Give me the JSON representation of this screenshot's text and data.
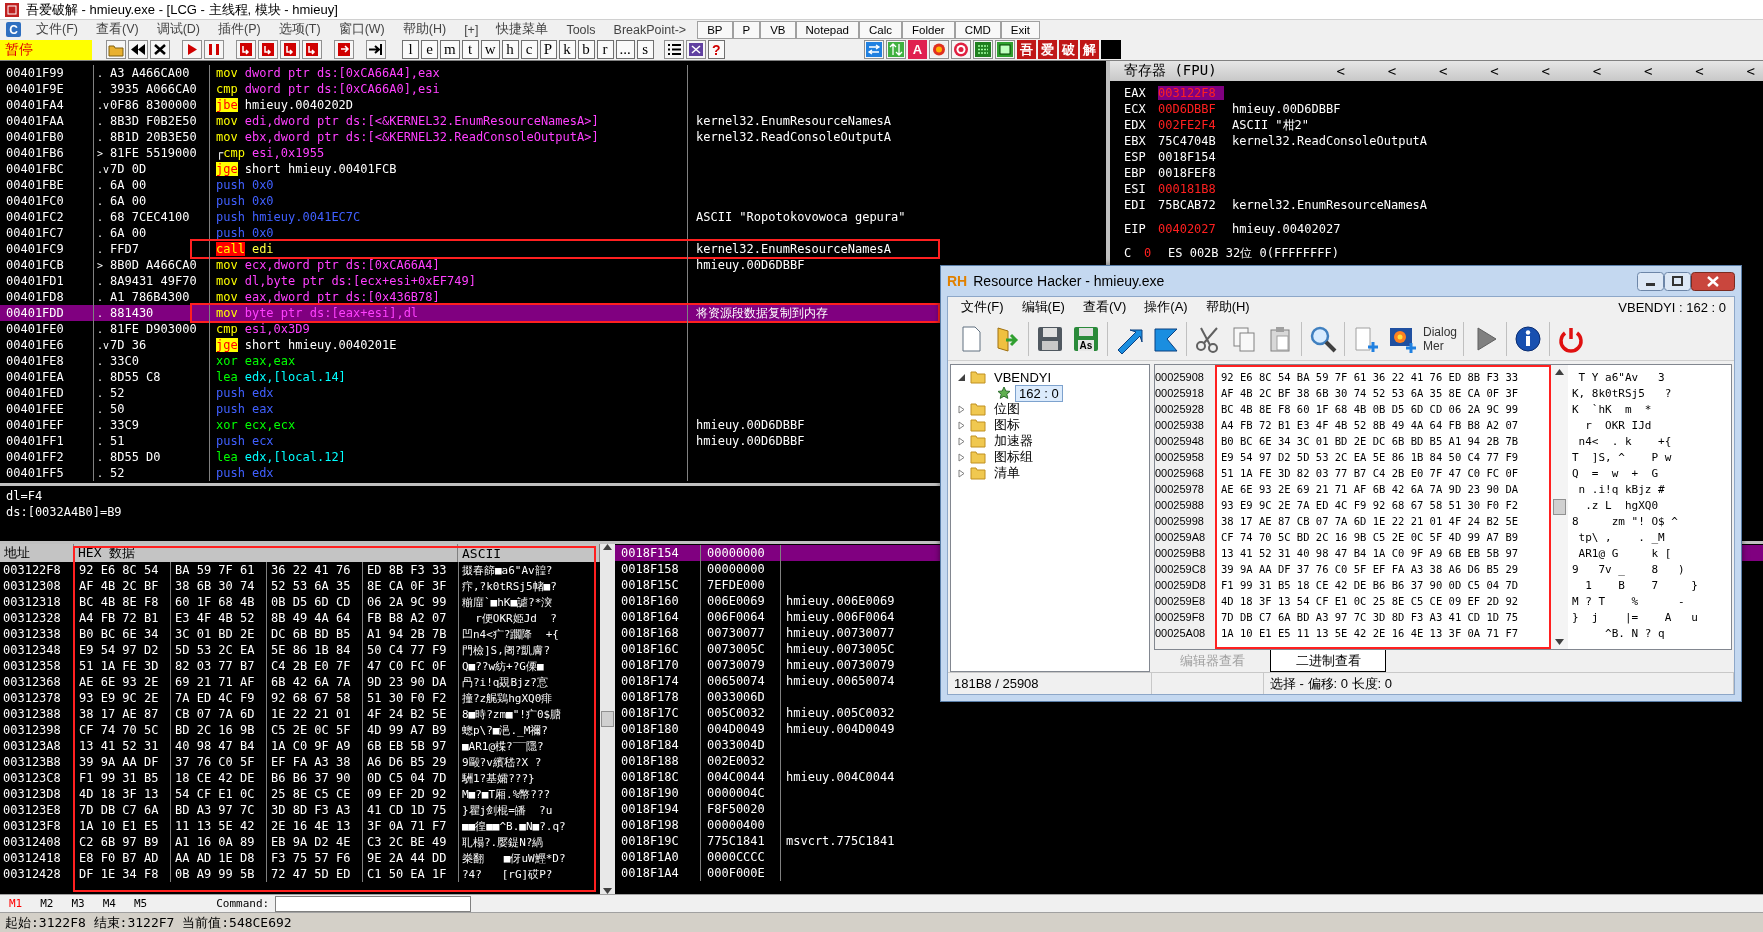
{
  "window": {
    "title": "吾爱破解 - hmieuy.exe - [LCG - 主线程, 模块 - hmieuy]"
  },
  "menu": {
    "logo": "C",
    "items": [
      "文件(F)",
      "查看(V)",
      "调试(D)",
      "插件(P)",
      "选项(T)",
      "窗口(W)",
      "帮助(H)",
      "[+]",
      "快捷菜单",
      "Tools",
      "BreakPoint->"
    ],
    "quick_buttons": [
      "BP",
      "P",
      "VB",
      "Notepad",
      "Calc",
      "Folder",
      "CMD",
      "Exit"
    ]
  },
  "toolbar": {
    "status": "暂停",
    "letter_buttons": [
      "l",
      "e",
      "m",
      "t",
      "w",
      "h",
      "c",
      "P",
      "k",
      "b",
      "r",
      "...",
      "s"
    ],
    "help": "?",
    "letter_icon": "A",
    "brand_keys": [
      "吾",
      "爱",
      "破",
      "解"
    ]
  },
  "disassembly": {
    "rows": [
      {
        "address": "00401F99",
        "mark": ".",
        "bytes": "A3 A466CA00",
        "op": "mov",
        "args": "dword ptr ds:[0xCA66A4],eax",
        "kind": "mov",
        "selected": false,
        "boxed": false
      },
      {
        "address": "00401F9E",
        "mark": ".",
        "bytes": "3935 A066CA0",
        "op": "cmp",
        "args": "dword ptr ds:[0xCA66A0],esi",
        "kind": "mov",
        "selected": false,
        "boxed": false
      },
      {
        "address": "00401FA4",
        "mark": ".v",
        "bytes": "0F86 8300000",
        "op": "jbe",
        "args": "hmieuy.0040202D",
        "kind": "jump",
        "selected": false,
        "boxed": false
      },
      {
        "address": "00401FAA",
        "mark": ".",
        "bytes": "8B3D F0B2E50",
        "op": "mov",
        "args": "edi,dword ptr ds:[<&KERNEL32.EnumResourceNamesA>]",
        "kind": "mov",
        "comment": "kernel32.EnumResourceNamesA",
        "selected": false,
        "boxed": false
      },
      {
        "address": "00401FB0",
        "mark": ".",
        "bytes": "8B1D 20B3E50",
        "op": "mov",
        "args": "ebx,dword ptr ds:[<&KERNEL32.ReadConsoleOutputA>]",
        "kind": "mov",
        "comment": "kernel32.ReadConsoleOutputA",
        "selected": false,
        "boxed": false
      },
      {
        "address": "00401FB6",
        "mark": ">",
        "bytes": "81FE 5519000",
        "loop": "┌",
        "op": "cmp",
        "args": "esi,0x1955",
        "kind": "mov",
        "selected": false,
        "boxed": false
      },
      {
        "address": "00401FBC",
        "mark": ".v",
        "bytes": "7D 0D",
        "op": "jge",
        "args": "short hmieuy.00401FCB",
        "kind": "jump",
        "selected": false,
        "boxed": false
      },
      {
        "address": "00401FBE",
        "mark": ".",
        "bytes": "6A 00",
        "op": "push",
        "args": "0x0",
        "kind": "push",
        "selected": false,
        "boxed": false
      },
      {
        "address": "00401FC0",
        "mark": ".",
        "bytes": "6A 00",
        "op": "push",
        "args": "0x0",
        "kind": "push",
        "selected": false,
        "boxed": false
      },
      {
        "address": "00401FC2",
        "mark": ".",
        "bytes": "68 7CEC4100",
        "op": "push",
        "args": "hmieuy.0041EC7C",
        "kind": "push",
        "comment": "ASCII \"Ropotokovowoca gepura\"",
        "selected": false,
        "boxed": false
      },
      {
        "address": "00401FC7",
        "mark": ".",
        "bytes": "6A 00",
        "op": "push",
        "args": "0x0",
        "kind": "push",
        "selected": false,
        "boxed": false
      },
      {
        "address": "00401FC9",
        "mark": ".",
        "bytes": "FFD7",
        "op": "call",
        "args": "edi",
        "kind": "call",
        "comment": "kernel32.EnumResourceNamesA",
        "selected": false,
        "boxed": true
      },
      {
        "address": "00401FCB",
        "mark": ">",
        "bytes": "8B0D A466CA0",
        "op": "mov",
        "args": "ecx,dword ptr ds:[0xCA66A4]",
        "kind": "mov",
        "comment": "hmieuy.00D6DBBF",
        "selected": false,
        "boxed": false
      },
      {
        "address": "00401FD1",
        "mark": ".",
        "bytes": "8A9431 49F70",
        "op": "mov",
        "args": "dl,byte ptr ds:[ecx+esi+0xEF749]",
        "kind": "mov",
        "selected": false,
        "boxed": false
      },
      {
        "address": "00401FD8",
        "mark": ".",
        "bytes": "A1 786B4300",
        "op": "mov",
        "args": "eax,dword ptr ds:[0x436B78]",
        "kind": "mov",
        "selected": false,
        "boxed": false
      },
      {
        "address": "00401FDD",
        "mark": ".",
        "bytes": "881430",
        "op": "mov",
        "args": "byte ptr ds:[eax+esi],dl",
        "kind": "mov",
        "comment": "将资源段数据复制到内存",
        "selected": true,
        "boxed": true
      },
      {
        "address": "00401FE0",
        "mark": ".",
        "bytes": "81FE D903000",
        "op": "cmp",
        "args": "esi,0x3D9",
        "kind": "mov",
        "selected": false,
        "boxed": false
      },
      {
        "address": "00401FE6",
        "mark": ".v",
        "bytes": "7D 36",
        "op": "jge",
        "args": "short hmieuy.0040201E",
        "kind": "jump",
        "selected": false,
        "boxed": false
      },
      {
        "address": "00401FE8",
        "mark": ".",
        "bytes": "33C0",
        "op": "xor",
        "args": "eax,eax",
        "kind": "arith",
        "selected": false,
        "boxed": false
      },
      {
        "address": "00401FEA",
        "mark": ".",
        "bytes": "8D55 C8",
        "op": "lea",
        "args": "edx,[local.14]",
        "kind": "lea",
        "selected": false,
        "boxed": false
      },
      {
        "address": "00401FED",
        "mark": ".",
        "bytes": "52",
        "op": "push",
        "args": "edx",
        "kind": "push",
        "selected": false,
        "boxed": false
      },
      {
        "address": "00401FEE",
        "mark": ".",
        "bytes": "50",
        "op": "push",
        "args": "eax",
        "kind": "push",
        "selected": false,
        "boxed": false
      },
      {
        "address": "00401FEF",
        "mark": ".",
        "bytes": "33C9",
        "op": "xor",
        "args": "ecx,ecx",
        "kind": "arith",
        "comment": "hmieuy.00D6DBBF",
        "selected": false,
        "boxed": false
      },
      {
        "address": "00401FF1",
        "mark": ".",
        "bytes": "51",
        "op": "push",
        "args": "ecx",
        "kind": "push",
        "comment": "hmieuy.00D6DBBF",
        "selected": false,
        "boxed": false
      },
      {
        "address": "00401FF2",
        "mark": ".",
        "bytes": "8D55 D0",
        "op": "lea",
        "args": "edx,[local.12]",
        "kind": "lea",
        "selected": false,
        "boxed": false
      },
      {
        "address": "00401FF5",
        "mark": ".",
        "bytes": "52",
        "op": "push",
        "args": "edx",
        "kind": "push",
        "selected": false,
        "boxed": false
      }
    ]
  },
  "info": [
    "dl=F4",
    "ds:[0032A4B0]=B9"
  ],
  "registers": {
    "title": "寄存器 (FPU)",
    "arrows": [
      "<",
      "<",
      "<",
      "<",
      "<",
      "<",
      "<",
      "<",
      "<"
    ],
    "groups": [
      [
        {
          "name": "EAX",
          "value": "003122F8",
          "changed": true,
          "selected": true
        },
        {
          "name": "ECX",
          "value": "00D6DBBF",
          "comment": "hmieuy.00D6DBBF",
          "changed": true,
          "selected": false
        },
        {
          "name": "EDX",
          "value": "002FE2F4",
          "comment": "ASCII \"柑2\"",
          "changed": true,
          "selected": false
        },
        {
          "name": "EBX",
          "value": "75C4704B",
          "comment": "kernel32.ReadConsoleOutputA",
          "changed": false,
          "selected": false
        },
        {
          "name": "ESP",
          "value": "0018F154",
          "changed": false,
          "selected": false
        },
        {
          "name": "EBP",
          "value": "0018FEF8",
          "changed": false,
          "selected": false
        },
        {
          "name": "ESI",
          "value": "000181B8",
          "changed": true,
          "selected": false
        },
        {
          "name": "EDI",
          "value": "75BCAB72",
          "comment": "kernel32.EnumResourceNamesA",
          "changed": false,
          "selected": false
        }
      ],
      [
        {
          "name": "EIP",
          "value": "00402027",
          "comment": "hmieuy.00402027",
          "changed": true,
          "selected": false
        }
      ]
    ],
    "flags": {
      "flag": "C",
      "value": "0",
      "changed": true,
      "rest": "ES 002B 32位 0(FFFFFFFF)"
    }
  },
  "dump": {
    "columns": [
      "地址",
      "HEX 数据",
      "ASCII"
    ],
    "boxed": true,
    "rows": [
      {
        "address": "003122F8",
        "hex": [
          "92 E6 8C 54",
          "BA 59 7F 61",
          "36 22 41 76",
          "ED 8B F3 33"
        ],
        "ascii": "掇春篩■a6\"Av韹?"
      },
      {
        "address": "00312308",
        "hex": [
          "AF 4B 2C BF",
          "38 6B 30 74",
          "52 53 6A 35",
          "8E CA 0F 3F"
        ],
        "ascii": "疜,?k0tRSj5帾■?"
      },
      {
        "address": "00312318",
        "hex": [
          "BC 4B 8E F8",
          "60 1F 68 4B",
          "0B D5 6D CD",
          "06 2A 9C 99"
        ],
        "ascii": "糋庿`■hK■謔?*湥"
      },
      {
        "address": "00312328",
        "hex": [
          "A4 FB 72 B1",
          "E3 4F 4B 52",
          "8B 49 4A 64",
          "FB B8 A2 07"
        ],
        "ascii": "  r便OKR姫Jd  ?"
      },
      {
        "address": "00312338",
        "hex": [
          "B0 BC 6E 34",
          "3C 01 BD 2E",
          "DC 6B BD B5",
          "A1 94 2B 7B"
        ],
        "ascii": "凹n4<疒?躢降  +{"
      },
      {
        "address": "00312348",
        "hex": [
          "E9 54 97 D2",
          "5D 53 2C EA",
          "5E 86 1B 84",
          "50 C4 77 F9"
        ],
        "ascii": "門檢]S,阇?凱膚?"
      },
      {
        "address": "00312358",
        "hex": [
          "51 1A FE 3D",
          "82 03 77 B7",
          "C4 2B E0 7F",
          "47 C0 FC 0F"
        ],
        "ascii": "Q■??w紡+?G傈■"
      },
      {
        "address": "00312368",
        "hex": [
          "AE 6E 93 2E",
          "69 21 71 AF",
          "6B 42 6A 7A",
          "9D 23 90 DA"
        ],
        "ascii": "冎?i!q覝Bjz?悹"
      },
      {
        "address": "00312378",
        "hex": [
          "93 E9 9C 2E",
          "7A ED 4C F9",
          "92 68 67 58",
          "51 30 F0 F2"
        ],
        "ascii": "撞?z艉鶏hgXQ0痱"
      },
      {
        "address": "00312388",
        "hex": [
          "38 17 AE 87",
          "CB 07 7A 6D",
          "1E 22 21 01",
          "4F 24 B2 5E"
        ],
        "ascii": "8■時?zm■\"!疒0$膅"
      },
      {
        "address": "00312398",
        "hex": [
          "CF 74 70 5C",
          "BD 2C 16 9B",
          "C5 2E 0C 5F",
          "4D 99 A7 B9"
        ],
        "ascii": "蟌p\\?■浥._M禰?"
      },
      {
        "address": "003123A8",
        "hex": [
          "13 41 52 31",
          "40 98 47 B4",
          "1A C0 9F A9",
          "6B EB 5B 97"
        ],
        "ascii": "■AR1@楪?‾‾隱?"
      },
      {
        "address": "003123B8",
        "hex": [
          "39 9A AA DF",
          "37 76 C0 5F",
          "EF FA A3 38",
          "A6 D6 B5 29"
        ],
        "ascii": "9毆?v繽嵇?X ?"
      },
      {
        "address": "003123C8",
        "hex": [
          "F1 99 31 B5",
          "18 CE 42 DE",
          "B6 B6 37 90",
          "0D C5 04 7D"
        ],
        "ascii": "駲1?基孀???}"
      },
      {
        "address": "003123D8",
        "hex": [
          "4D 18 3F 13",
          "54 CF E1 0C",
          "25 8E C5 CE",
          "09 EF 2D 92"
        ],
        "ascii": "M■?■T厢.%幣???"
      },
      {
        "address": "003123E8",
        "hex": [
          "7D DB C7 6A",
          "BD A3 97 7C",
          "3D 8D F3 A3",
          "41 CD 1D 75"
        ],
        "ascii": "}瞿j剑棍=皤  ?u"
      },
      {
        "address": "003123F8",
        "hex": [
          "1A 10 E1 E5",
          "11 13 5E 42",
          "2E 16 4E 13",
          "3F 0A 71 F7"
        ],
        "ascii": "■■徨■■^B.■N■?.q?"
      },
      {
        "address": "00312408",
        "hex": [
          "C2 6B 97 B9",
          "A1 16 0A 89",
          "EB 9A D2 4E",
          "C3 2C BE 49"
        ],
        "ascii": "耴榻?.嬮鍉N?緺"
      },
      {
        "address": "00312418",
        "hex": [
          "E8 F0 B7 AD",
          "AA AD 1E D8",
          "F3 75 57 F6",
          "9E 2A 44 DD"
        ],
        "ascii": "桊翻   ■伢uW鰹*D?"
      },
      {
        "address": "00312428",
        "hex": [
          "DF 1E 34 F8",
          "0B A9 99 5B",
          "72 47 5D ED",
          "C1 50 EA 1F"
        ],
        "ascii": "?4?   [rG]砹P?"
      }
    ]
  },
  "stack": {
    "rows": [
      {
        "address": "0018F154",
        "value": "00000000",
        "selected": true
      },
      {
        "address": "0018F158",
        "value": "00000000",
        "selected": false
      },
      {
        "address": "0018F15C",
        "value": "7EFDE000",
        "selected": false
      },
      {
        "address": "0018F160",
        "value": "006E0069",
        "comment": "hmieuy.006E0069",
        "selected": false
      },
      {
        "address": "0018F164",
        "value": "006F0064",
        "comment": "hmieuy.006F0064",
        "selected": false
      },
      {
        "address": "0018F168",
        "value": "00730077",
        "comment": "hmieuy.00730077",
        "selected": false
      },
      {
        "address": "0018F16C",
        "value": "0073005C",
        "comment": "hmieuy.0073005C",
        "selected": false
      },
      {
        "address": "0018F170",
        "value": "00730079",
        "comment": "hmieuy.00730079",
        "selected": false
      },
      {
        "address": "0018F174",
        "value": "00650074",
        "comment": "hmieuy.00650074",
        "selected": false
      },
      {
        "address": "0018F178",
        "value": "0033006D",
        "selected": false
      },
      {
        "address": "0018F17C",
        "value": "005C0032",
        "comment": "hmieuy.005C0032",
        "selected": false
      },
      {
        "address": "0018F180",
        "value": "004D0049",
        "comment": "hmieuy.004D0049",
        "selected": false
      },
      {
        "address": "0018F184",
        "value": "0033004D",
        "selected": false
      },
      {
        "address": "0018F188",
        "value": "002E0032",
        "selected": false
      },
      {
        "address": "0018F18C",
        "value": "004C0044",
        "comment": "hmieuy.004C0044",
        "selected": false
      },
      {
        "address": "0018F190",
        "value": "0000004C",
        "selected": false
      },
      {
        "address": "0018F194",
        "value": "F8F50020",
        "selected": false
      },
      {
        "address": "0018F198",
        "value": "00000400",
        "selected": false
      },
      {
        "address": "0018F19C",
        "value": "775C1841",
        "comment": "msvcrt.775C1841",
        "selected": false
      },
      {
        "address": "0018F1A0",
        "value": "0000CCCC",
        "selected": false
      },
      {
        "address": "0018F1A4",
        "value": "000F000E",
        "selected": false
      }
    ]
  },
  "command_bar": {
    "tabs": [
      {
        "label": "M1",
        "selected": true
      },
      {
        "label": "M2",
        "selected": false
      },
      {
        "label": "M3",
        "selected": false
      },
      {
        "label": "M4",
        "selected": false
      },
      {
        "label": "M5",
        "selected": false
      }
    ],
    "label": "Command:"
  },
  "status_bar": "起始:3122F8 结束:3122F7 当前值:548CE692",
  "resource_hacker": {
    "logo": "RH",
    "title": "Resource Hacker - hmieuy.exe",
    "menu": [
      "文件(F)",
      "编辑(E)",
      "查看(V)",
      "操作(A)",
      "帮助(H)"
    ],
    "selection": "VBENDYI : 162 : 0",
    "save_as_label": "As",
    "dialog_menu_label": [
      "Dialog",
      "Mer"
    ],
    "tree": [
      {
        "label": "VBENDYI",
        "expanded": true,
        "children": [
          {
            "label": "162 : 0",
            "selected": true
          }
        ]
      },
      {
        "label": "位图",
        "expanded": false
      },
      {
        "label": "图标",
        "expanded": false
      },
      {
        "label": "加速器",
        "expanded": false
      },
      {
        "label": "图标组",
        "expanded": false
      },
      {
        "label": "清单",
        "expanded": false
      }
    ],
    "hex": {
      "boxed": true,
      "rows": [
        {
          "address": "00025908",
          "hex": "92 E6 8C 54 BA 59 7F 61 36 22 41 76 ED 8B F3 33",
          "ascii": " T Y a6\"Av   3"
        },
        {
          "address": "00025918",
          "hex": "AF 4B 2C BF 38 6B 30 74 52 53 6A 35 8E CA 0F 3F",
          "ascii": "K, 8k0tRSj5   ?"
        },
        {
          "address": "00025928",
          "hex": "BC 4B 8E F8 60 1F 68 4B 0B D5 6D CD 06 2A 9C 99",
          "ascii": "K  `hK  m  *"
        },
        {
          "address": "00025938",
          "hex": "A4 FB 72 B1 E3 4F 4B 52 8B 49 4A 64 FB B8 A2 07",
          "ascii": "  r  OKR IJd"
        },
        {
          "address": "00025948",
          "hex": "B0 BC 6E 34 3C 01 BD 2E DC 6B BD B5 A1 94 2B 7B",
          "ascii": " n4<  . k    +{"
        },
        {
          "address": "00025958",
          "hex": "E9 54 97 D2 5D 53 2C EA 5E 86 1B 84 50 C4 77 F9",
          "ascii": "T  ]S, ^    P w"
        },
        {
          "address": "00025968",
          "hex": "51 1A FE 3D 82 03 77 B7 C4 2B E0 7F 47 C0 FC 0F",
          "ascii": "Q  =  w  +  G"
        },
        {
          "address": "00025978",
          "hex": "AE 6E 93 2E 69 21 71 AF 6B 42 6A 7A 9D 23 90 DA",
          "ascii": " n .i!q kBjz #"
        },
        {
          "address": "00025988",
          "hex": "93 E9 9C 2E 7A ED 4C F9 92 68 67 58 51 30 F0 F2",
          "ascii": "  .z L  hgXQ0"
        },
        {
          "address": "00025998",
          "hex": "38 17 AE 87 CB 07 7A 6D 1E 22 21 01 4F 24 B2 5E",
          "ascii": "8     zm \"! O$ ^"
        },
        {
          "address": "000259A8",
          "hex": "CF 74 70 5C BD 2C 16 9B C5 2E 0C 5F 4D 99 A7 B9",
          "ascii": " tp\\ ,    . _M"
        },
        {
          "address": "000259B8",
          "hex": "13 41 52 31 40 98 47 B4 1A C0 9F A9 6B EB 5B 97",
          "ascii": " AR1@ G     k ["
        },
        {
          "address": "000259C8",
          "hex": "39 9A AA DF 37 76 C0 5F EF FA A3 38 A6 D6 B5 29",
          "ascii": "9   7v _    8   )"
        },
        {
          "address": "000259D8",
          "hex": "F1 99 31 B5 18 CE 42 DE B6 B6 37 90 0D C5 04 7D",
          "ascii": "  1    B    7     }"
        },
        {
          "address": "000259E8",
          "hex": "4D 18 3F 13 54 CF E1 0C 25 8E C5 CE 09 EF 2D 92",
          "ascii": "M ? T    %      -"
        },
        {
          "address": "000259F8",
          "hex": "7D DB C7 6A BD A3 97 7C 3D 8D F3 A3 41 CD 1D 75",
          "ascii": "}  j    |=    A   u"
        },
        {
          "address": "00025A08",
          "hex": "1A 10 E1 E5 11 13 5E 42 2E 16 4E 13 3F 0A 71 F7",
          "ascii": "     ^B. N ? q"
        }
      ]
    },
    "tabs": [
      {
        "label": "编辑器查看",
        "selected": false
      },
      {
        "label": "二进制查看",
        "selected": true
      }
    ],
    "status": [
      "181B8 / 25908",
      "选择 - 偏移: 0 长度: 0"
    ]
  }
}
